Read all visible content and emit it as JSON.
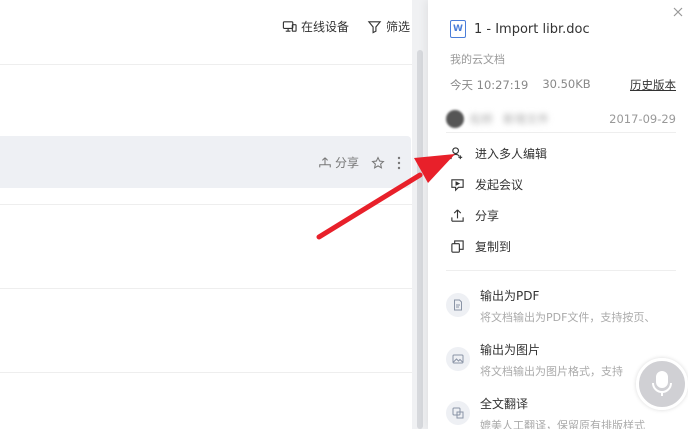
{
  "toolbar": {
    "online_devices": "在线设备",
    "filter": "筛选"
  },
  "row": {
    "share": "分享"
  },
  "panel": {
    "file_name": "1 - Import libr.doc",
    "doc_icon": "W",
    "location": "我的云文档",
    "modified_time": "今天 10:27:19",
    "file_size": "30.50KB",
    "history_link": "历史版本",
    "activity": {
      "user": "松桥",
      "action": "新增文件",
      "date": "2017-09-29"
    },
    "menu": [
      {
        "label": "进入多人编辑",
        "icon": "multi-user-edit-icon"
      },
      {
        "label": "发起会议",
        "icon": "meeting-icon"
      },
      {
        "label": "分享",
        "icon": "share-icon"
      },
      {
        "label": "复制到",
        "icon": "copy-icon"
      }
    ],
    "exports": [
      {
        "title": "输出为PDF",
        "desc": "将文档输出为PDF文件，支持按页、",
        "icon": "pdf-icon"
      },
      {
        "title": "输出为图片",
        "desc": "将文档输出为图片格式，支持",
        "icon": "image-icon"
      },
      {
        "title": "全文翻译",
        "desc": "媲美人工翻译，保留原有排版样式",
        "icon": "translate-icon"
      }
    ]
  },
  "colors": {
    "annotation_arrow": "#e8202a",
    "accent": "#4b7ed9"
  }
}
